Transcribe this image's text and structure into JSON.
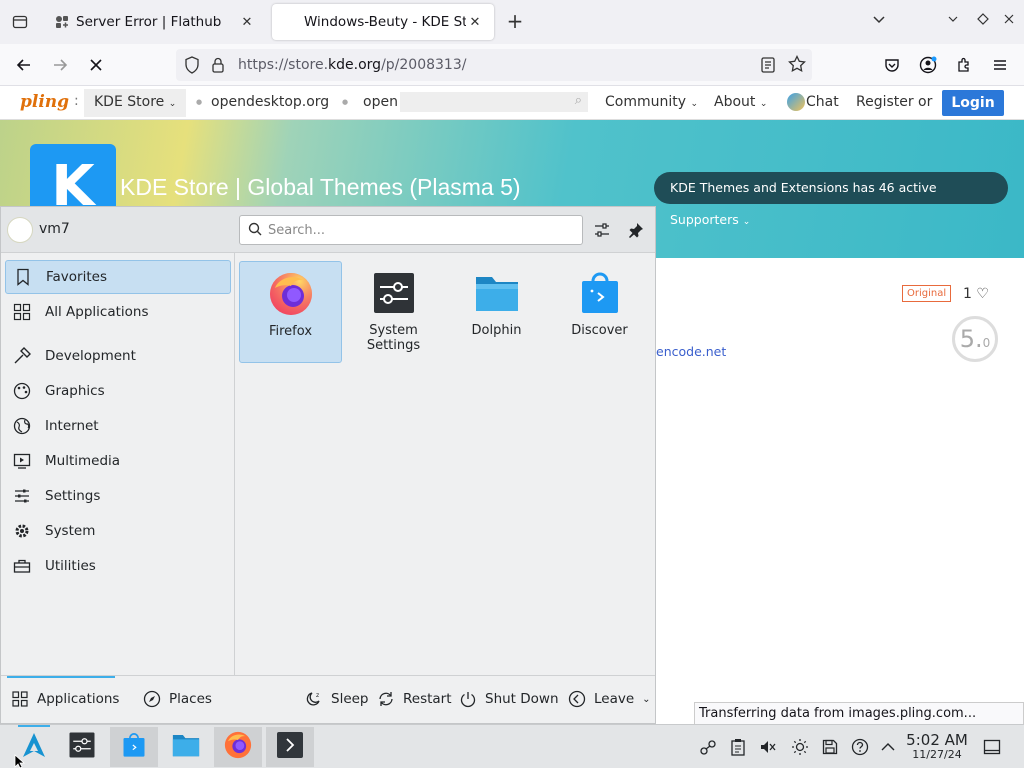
{
  "browser": {
    "tabs": [
      {
        "title": "Server Error | Flathub",
        "active": false
      },
      {
        "title": "Windows-Beuty - KDE Stor",
        "active": true
      }
    ],
    "url_prefix": "https://store.",
    "url_domain": "kde.org",
    "url_path": "/p/2008313/"
  },
  "site": {
    "brand": "pling",
    "store": "KDE Store",
    "links": [
      "opendesktop.org",
      "open"
    ],
    "community": "Community",
    "about": "About",
    "chat": "Chat",
    "register": "Register",
    "or": "or",
    "login": "Login",
    "banner_title": "KDE Store  |  Global Themes (Plasma 5)",
    "supporters": "KDE Themes and Extensions has 46 active Supporters",
    "badge_original": "Original",
    "likes": "1",
    "rating_big": "5.",
    "rating_small": "0",
    "link_fragment": "encode.net",
    "status_text": "Transferring data from images.pling.com..."
  },
  "launcher": {
    "username": "vm7",
    "search_placeholder": "Search...",
    "categories": [
      "Favorites",
      "All Applications",
      "Development",
      "Graphics",
      "Internet",
      "Multimedia",
      "Settings",
      "System",
      "Utilities"
    ],
    "apps": [
      {
        "name": "Firefox",
        "icon": "firefox-icon"
      },
      {
        "name": "System Settings",
        "icon": "system-settings-icon"
      },
      {
        "name": "Dolphin",
        "icon": "dolphin-icon"
      },
      {
        "name": "Discover",
        "icon": "discover-icon"
      }
    ],
    "footer": {
      "applications": "Applications",
      "places": "Places",
      "sleep": "Sleep",
      "restart": "Restart",
      "shutdown": "Shut Down",
      "leave": "Leave"
    }
  },
  "panel": {
    "time": "5:02 AM",
    "date": "11/27/24"
  },
  "colors": {
    "accent": "#3daee9",
    "selection": "#c7dff2",
    "login": "#2b78d9",
    "kde_blue": "#1d99f3"
  }
}
